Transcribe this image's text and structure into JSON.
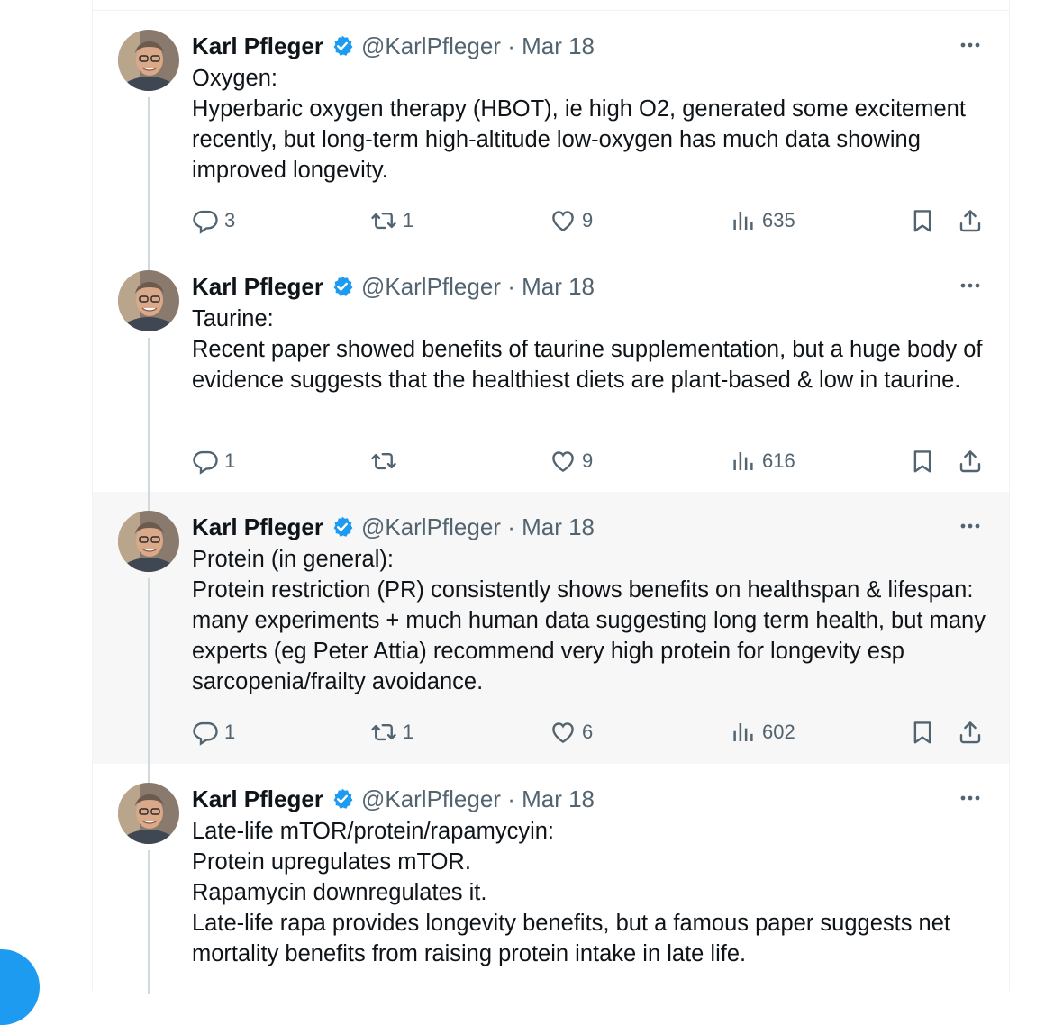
{
  "tweets": [
    {
      "name": "Karl Pfleger",
      "handle": "@KarlPfleger",
      "date": "Mar 18",
      "text": "Oxygen:\nHyperbaric oxygen therapy (HBOT), ie high O2, generated some excitement recently, but long-term high-altitude low-oxygen has much data showing improved longevity.",
      "replies": "3",
      "reposts": "1",
      "likes": "9",
      "views": "635"
    },
    {
      "name": "Karl Pfleger",
      "handle": "@KarlPfleger",
      "date": "Mar 18",
      "text": "Taurine:\nRecent paper showed benefits of taurine supplementation, but a huge body of evidence suggests that the healthiest diets are plant-based & low in taurine.",
      "replies": "1",
      "reposts": "",
      "likes": "9",
      "views": "616"
    },
    {
      "name": "Karl Pfleger",
      "handle": "@KarlPfleger",
      "date": "Mar 18",
      "text": "Protein (in general):\nProtein restriction (PR) consistently shows benefits on healthspan & lifespan: many experiments + much human data suggesting long term health, but many experts (eg Peter Attia) recommend very high protein for longevity esp sarcopenia/frailty avoidance.",
      "replies": "1",
      "reposts": "1",
      "likes": "6",
      "views": "602"
    },
    {
      "name": "Karl Pfleger",
      "handle": "@KarlPfleger",
      "date": "Mar 18",
      "text": "Late-life mTOR/protein/rapamycyin:\nProtein upregulates mTOR.\nRapamycin downregulates it.\nLate-life rapa provides longevity benefits, but a famous paper suggests net mortality benefits from raising protein intake in late life."
    }
  ],
  "separator": " · ",
  "colors": {
    "accent": "#1d9bf0",
    "muted": "#536471",
    "highlight_bg": "#f7f7f7"
  },
  "icons": [
    "verified-badge-icon",
    "more-icon",
    "reply-icon",
    "repost-icon",
    "like-icon",
    "views-icon",
    "bookmark-icon",
    "share-icon"
  ]
}
